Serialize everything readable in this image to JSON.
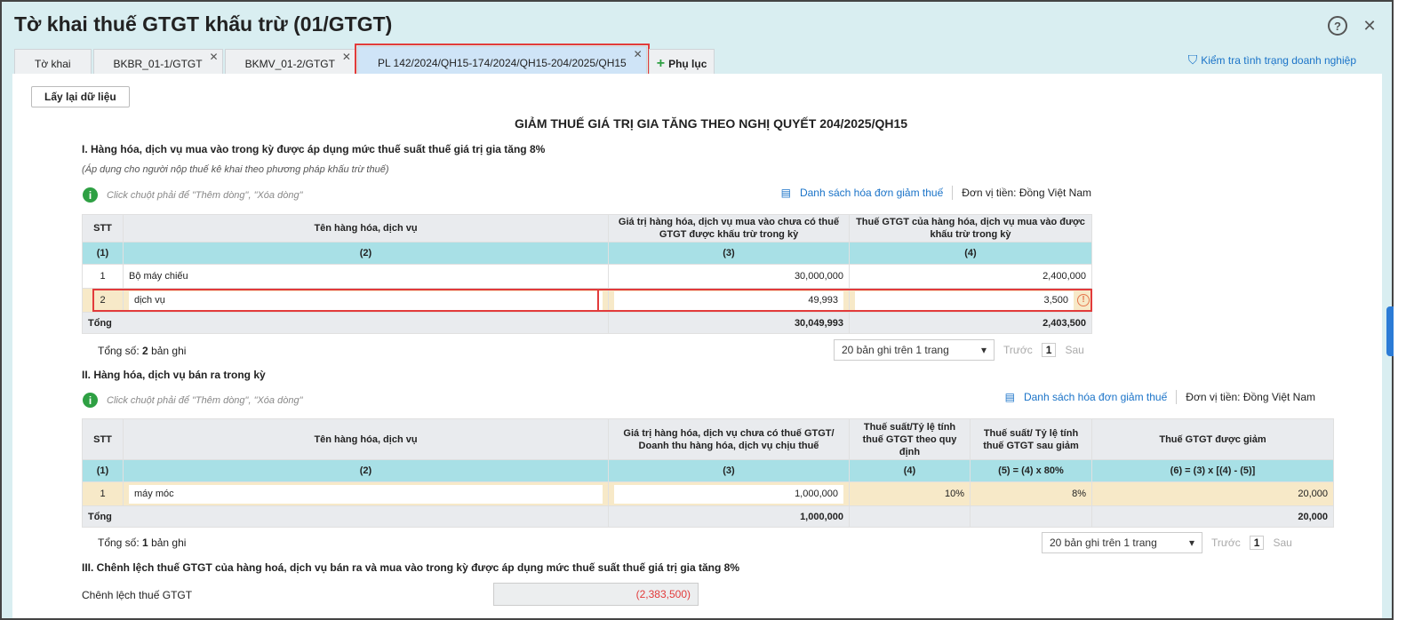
{
  "window": {
    "title": "Tờ khai thuế GTGT khấu trừ (01/GTGT)",
    "help_icon": "?",
    "close_icon": "✕"
  },
  "tabs": [
    {
      "label": "Tờ khai"
    },
    {
      "label": "BKBR_01-1/GTGT"
    },
    {
      "label": "BKMV_01-2/GTGT"
    },
    {
      "label": "PL 142/2024/QH15-174/2024/QH15-204/2025/QH15"
    }
  ],
  "add_tab": "Phụ lục",
  "check_link": "Kiểm tra tình trạng doanh nghiệp",
  "reload_button": "Lấy lại dữ liệu",
  "main_title": "GIẢM THUẾ GIÁ TRỊ GIA TĂNG THEO NGHỊ QUYẾT 204/2025/QH15",
  "hint": "Click chuột phải để \"Thêm dòng\", \"Xóa dòng\"",
  "invoice_link": "Danh sách hóa đơn giảm thuế",
  "currency": "Đơn vị tiền: Đồng Việt Nam",
  "section1": {
    "title": "I. Hàng hóa, dịch vụ mua vào trong kỳ được áp dụng mức thuế suất thuế giá trị gia tăng 8%",
    "note": "(Áp dụng cho người nộp thuế kê khai theo phương pháp khấu trừ thuế)",
    "headers": [
      "STT",
      "Tên hàng hóa, dịch vụ",
      "Giá trị hàng hóa, dịch vụ mua vào chưa có thuế GTGT được khấu trừ trong kỳ",
      "Thuế GTGT của hàng hóa, dịch vụ mua vào được khấu trừ trong kỳ"
    ],
    "col_numbers": [
      "(1)",
      "(2)",
      "(3)",
      "(4)"
    ],
    "rows": [
      [
        "1",
        "Bộ máy chiếu",
        "30,000,000",
        "2,400,000"
      ],
      [
        "2",
        "dịch vụ",
        "49,993",
        "3,500"
      ]
    ],
    "total": {
      "label": "Tổng",
      "c3": "30,049,993",
      "c4": "2,403,500"
    },
    "count_label": "Tổng số:",
    "count": "2",
    "count_suffix": "bản ghi",
    "page_size": "20 bản ghi trên 1 trang",
    "prev": "Trước",
    "page": "1",
    "next": "Sau"
  },
  "section2": {
    "title": "II. Hàng hóa, dịch vụ bán ra trong kỳ",
    "headers": [
      "STT",
      "Tên hàng hóa, dịch vụ",
      "Giá trị hàng hóa, dịch vụ chưa có thuế GTGT/ Doanh thu hàng hóa, dịch vụ chịu thuế",
      "Thuế suất/Tỷ lệ tính thuế GTGT theo quy định",
      "Thuế suất/ Tỷ lệ tính thuế GTGT sau giảm",
      "Thuế GTGT được giảm"
    ],
    "col_numbers": [
      "(1)",
      "(2)",
      "(3)",
      "(4)",
      "(5) = (4) x 80%",
      "(6) = (3) x [(4) - (5)]"
    ],
    "rows": [
      [
        "1",
        "máy móc",
        "1,000,000",
        "10%",
        "8%",
        "20,000"
      ]
    ],
    "total": {
      "label": "Tổng",
      "c3": "1,000,000",
      "c6": "20,000"
    },
    "count_label": "Tổng số:",
    "count": "1",
    "count_suffix": "bản ghi",
    "page_size": "20 bản ghi trên 1 trang",
    "prev": "Trước",
    "page": "1",
    "next": "Sau"
  },
  "section3": {
    "title": "III. Chênh lệch thuế GTGT của hàng hoá, dịch vụ bán ra và mua vào trong kỳ được áp dụng mức thuế suất thuế giá trị gia tăng 8%",
    "label": "Chênh lệch thuế GTGT",
    "value": "(2,383,500)"
  }
}
